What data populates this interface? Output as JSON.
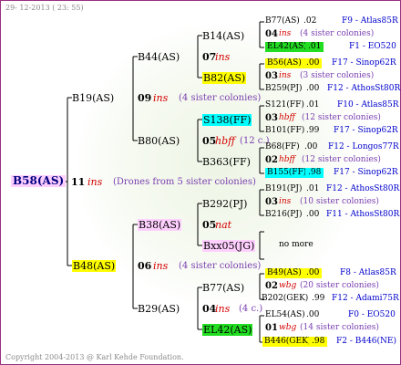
{
  "header": {
    "date": "29- 12-2013 ( 23: 55)"
  },
  "footer": {
    "copyright": "Copyright 2004-2013 @ Karl Kehde Foundation."
  },
  "gen1": {
    "name": "B58(AS)",
    "year": "11",
    "ins": "ins",
    "note": "(Drones from 5 sister colonies)"
  },
  "gen2": [
    {
      "name": "B19(AS)",
      "year": "09",
      "ins": "ins",
      "note": "(4 sister colonies)"
    },
    {
      "name": "B48(AS)",
      "year": "06",
      "ins": "ins",
      "note": "(4 sister colonies)"
    }
  ],
  "gen3": [
    {
      "name": "B44(AS)",
      "year": "07",
      "ins": "ins",
      "note": ""
    },
    {
      "name": "B80(AS)",
      "year": "05",
      "ins": "hbff",
      "note": "(12 c.)"
    },
    {
      "name": "B38(AS)",
      "year": "05",
      "ins": "nat",
      "note": ""
    },
    {
      "name": "B29(AS)",
      "year": "04",
      "ins": "ins",
      "note": "(4 c.)"
    }
  ],
  "gen4": [
    {
      "name": "B14(AS)"
    },
    {
      "name": "B82(AS)"
    },
    {
      "name": "S138(FF)"
    },
    {
      "name": "B363(FF)"
    },
    {
      "name": "B292(PJ)"
    },
    {
      "name": "Bxx05(JG)"
    },
    {
      "name": "B77(AS)"
    },
    {
      "name": "EL42(AS)"
    }
  ],
  "gen5": [
    {
      "top": {
        "name": "B77(AS)",
        "year": ".02",
        "place": "F9 - Atlas85R"
      },
      "mid": {
        "year": "04",
        "ins": "ins",
        "note": "(4 sister colonies)"
      },
      "bot": {
        "name": "EL42(AS)",
        "year": ".01",
        "place": "F1 - EO520"
      }
    },
    {
      "top": {
        "name": "B56(AS)",
        "year": ".00",
        "place": "F17 - Sinop62R"
      },
      "mid": {
        "year": "03",
        "ins": "ins",
        "note": "(3 sister colonies)"
      },
      "bot": {
        "name": "B259(PJ)",
        "year": ".00",
        "place": "F12 - AthosSt80R"
      }
    },
    {
      "top": {
        "name": "S121(FF)",
        "year": ".01",
        "place": "F10 - Atlas85R"
      },
      "mid": {
        "year": "03",
        "ins": "hbff",
        "note": "(12 sister colonies)"
      },
      "bot": {
        "name": "B101(FF)",
        "year": ".99",
        "place": "F17 - Sinop62R"
      }
    },
    {
      "top": {
        "name": "B68(FF)",
        "year": ".00",
        "place": "F12 - Longos77R"
      },
      "mid": {
        "year": "02",
        "ins": "hbff",
        "note": "(12 sister colonies)"
      },
      "bot": {
        "name": "B155(FF)",
        "year": ".98",
        "place": "F17 - Sinop62R"
      }
    },
    {
      "top": {
        "name": "B191(PJ)",
        "year": ".01",
        "place": "F12 - AthosSt80R"
      },
      "mid": {
        "year": "03",
        "ins": "ins",
        "note": "(10 sister colonies)"
      },
      "bot": {
        "name": "B216(PJ)",
        "year": ".00",
        "place": "F11 - AthosSt80R"
      }
    },
    {
      "more": "no more"
    },
    {
      "top": {
        "name": "B49(AS)",
        "year": ".00",
        "place": "F8 - Atlas85R"
      },
      "mid": {
        "year": "02",
        "ins": "wbg",
        "note": "(20 sister colonies)"
      },
      "bot": {
        "name": "B202(GEK)",
        "year": ".99",
        "place": "F12 - Adami75R"
      }
    },
    {
      "top": {
        "name": "EL54(AS)",
        "year": ".00",
        "place": "F0 - EO520"
      },
      "mid": {
        "year": "01",
        "ins": "wbg",
        "note": "(14 sister colonies)"
      },
      "bot": {
        "name": "B446(GEK)",
        "year": ".98",
        "place": "F2 - B446(NE)"
      }
    }
  ]
}
